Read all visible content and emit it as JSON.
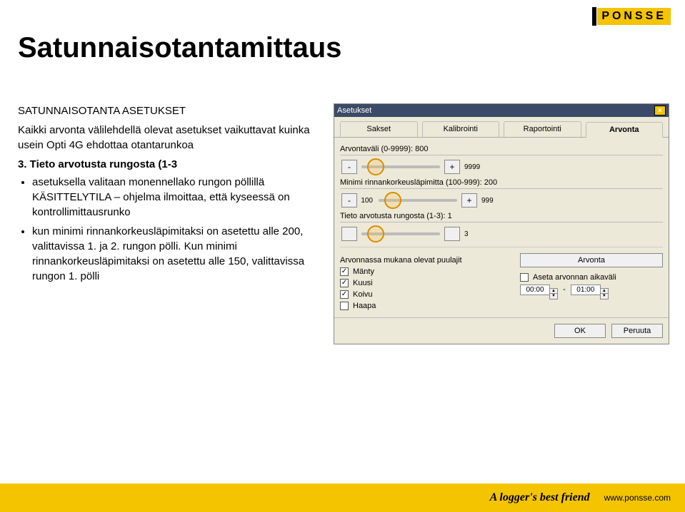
{
  "brand": {
    "name": "PONSSE",
    "tagline": "A logger's best friend",
    "url": "www.ponsse.com"
  },
  "page": {
    "title": "Satunnaisotantamittaus",
    "subheading": "SATUNNAISOTANTA ASETUKSET",
    "line1": "Kaikki arvonta välilehdellä olevat asetukset vaikuttavat kuinka usein Opti 4G ehdottaa otantarunkoa",
    "step3": "3. Tieto arvotusta rungosta (1-3",
    "bullets": [
      "asetuksella valitaan monennellako rungon pöllillä KÄSITTELYTILA – ohjelma ilmoittaa, että kyseessä on kontrollimittausrunko",
      "kun minimi rinnankorkeusläpimitaksi on asetettu alle 200, valittavissa 1. ja 2. rungon pölli. Kun minimi rinnankorkeusläpimitaksi on asetettu alle 150, valittavissa rungon 1. pölli"
    ]
  },
  "dialog": {
    "title": "Asetukset",
    "close": "×",
    "tabs": [
      "Sakset",
      "Kalibrointi",
      "Raportointi",
      "Arvonta"
    ],
    "active_tab": 3,
    "rows": [
      {
        "label": "Arvontaväli (0-9999): 800",
        "min": "-",
        "btn_l": "-",
        "btn_r": "+",
        "end": "9999"
      },
      {
        "label": "Minimi rinnankorkeusläpimitta (100-999): 200",
        "start": "100",
        "btn_l": "-",
        "btn_r": "+",
        "end": "999"
      },
      {
        "label": "Tieto arvotusta rungosta (1-3): 1",
        "start": "",
        "btn_l": "",
        "btn_r": "",
        "end": "3",
        "marker": true
      }
    ],
    "species_heading": "Arvonnassa mukana olevat puulajit",
    "arvonta_btn": "Arvonta",
    "species": [
      {
        "name": "Mänty",
        "checked": true
      },
      {
        "name": "Kuusi",
        "checked": true
      },
      {
        "name": "Koivu",
        "checked": true
      },
      {
        "name": "Haapa",
        "checked": false
      }
    ],
    "interval_chk": "Aseta arvonnan aikaväli",
    "time_from": "00:00",
    "time_to": "01:00",
    "ok": "OK",
    "cancel": "Peruuta"
  }
}
